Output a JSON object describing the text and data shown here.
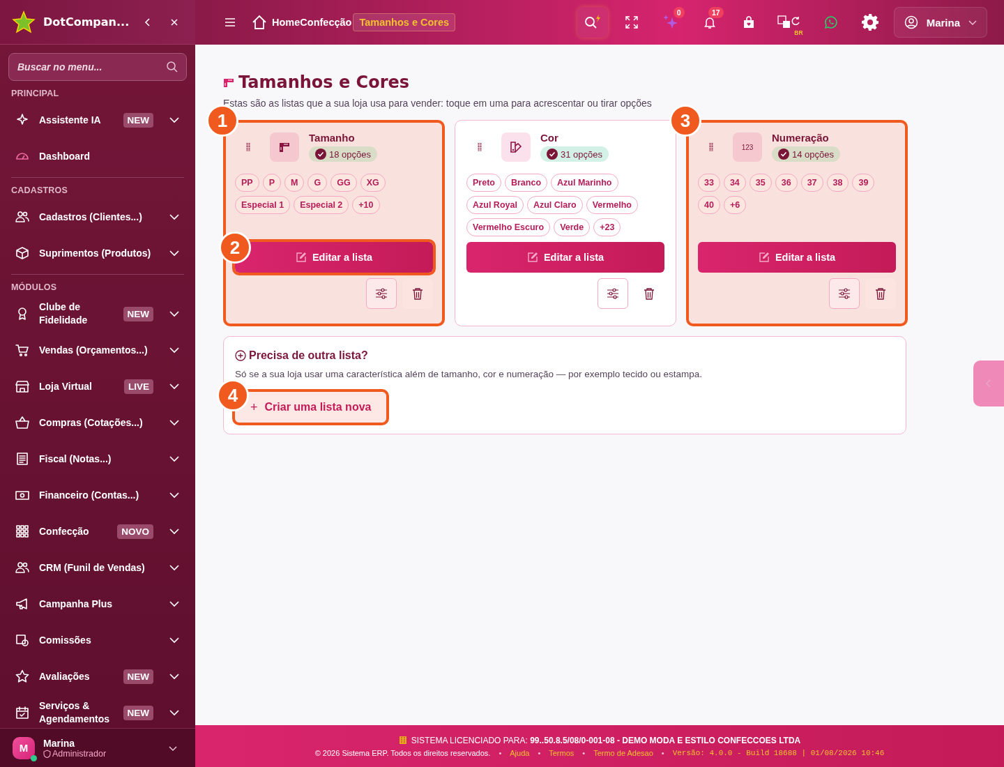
{
  "brand": {
    "name": "DotCompan..."
  },
  "sidebar": {
    "search": {
      "placeholder": "Buscar no menu..."
    },
    "sections": [
      {
        "title": "PRINCIPAL",
        "items": [
          {
            "label": "Assistente IA",
            "badge": "NEW",
            "submenu": true
          },
          {
            "label": "Dashboard",
            "submenu": false
          }
        ]
      },
      {
        "title": "CADASTROS",
        "items": [
          {
            "label": "Cadastros (Clientes...)",
            "submenu": true
          },
          {
            "label": "Suprimentos (Produtos)",
            "submenu": true
          }
        ]
      },
      {
        "title": "MÓDULOS",
        "items": [
          {
            "label": "Clube de Fidelidade",
            "badge": "NEW",
            "submenu": true
          },
          {
            "label": "Vendas (Orçamentos...)",
            "submenu": true
          },
          {
            "label": "Loja Virtual",
            "badge": "LIVE",
            "submenu": true
          },
          {
            "label": "Compras (Cotações...)",
            "submenu": true
          },
          {
            "label": "Fiscal (Notas...)",
            "submenu": true
          },
          {
            "label": "Financeiro (Contas...)",
            "submenu": true
          },
          {
            "label": "Confecção",
            "badge": "NOVO",
            "submenu": true
          },
          {
            "label": "CRM (Funil de Vendas)",
            "submenu": true
          },
          {
            "label": "Campanha Plus",
            "submenu": true
          },
          {
            "label": "Comissões",
            "submenu": true
          },
          {
            "label": "Avaliações",
            "badge": "NEW",
            "submenu": true
          },
          {
            "label": "Serviços & Agendamentos",
            "badge": "NEW",
            "submenu": true
          }
        ]
      }
    ],
    "user": {
      "initial": "M",
      "name": "Marina",
      "role": "Administrador",
      "online": true
    }
  },
  "topbar": {
    "breadcrumb": [
      "Home",
      "Confecção"
    ],
    "current": "Tamanhos e Cores",
    "notifications": [
      {
        "count": "0"
      },
      {
        "count": "17"
      }
    ],
    "language": "BR",
    "user": "Marina"
  },
  "page": {
    "title": "Tamanhos e Cores",
    "subtitle": "Estas são as listas que a sua loja usa para vender: toque em uma para acrescentar ou tirar opções"
  },
  "lists": [
    {
      "kind": "ruler",
      "name": "Tamanho",
      "count": "18 opções",
      "highlighted": true,
      "step": "1",
      "options": [
        "PP",
        "P",
        "M",
        "G",
        "GG",
        "XG",
        "Especial 1",
        "Especial 2",
        "+10"
      ],
      "edit_button": {
        "label": "Editar a lista",
        "highlighted": true,
        "step": "2"
      }
    },
    {
      "kind": "palette",
      "name": "Cor",
      "count": "31 opções",
      "highlighted": false,
      "options": [
        "Preto",
        "Branco",
        "Azul Marinho",
        "Azul Royal",
        "Azul Claro",
        "Vermelho",
        "Vermelho Escuro",
        "Verde",
        "+23"
      ],
      "edit_button": {
        "label": "Editar a lista",
        "highlighted": false
      }
    },
    {
      "kind": "numbers",
      "icon_text": "123",
      "name": "Numeração",
      "count": "14 opções",
      "highlighted": true,
      "step": "3",
      "options": [
        "33",
        "34",
        "35",
        "36",
        "37",
        "38",
        "39",
        "40",
        "+6"
      ],
      "edit_button": {
        "label": "Editar a lista",
        "highlighted": false
      }
    }
  ],
  "new_list": {
    "title": "Precisa de outra lista?",
    "text": "Só se a sua loja usar uma característica além de tamanho, cor e numeração — por exemplo tecido ou estampa.",
    "button": {
      "icon": "+",
      "label": "Criar uma lista nova",
      "highlighted": true,
      "step": "4"
    }
  },
  "footer": {
    "license": "SISTEMA LICENCIADO PARA: **99..50.8.5/08/0-001-08 - DEMO MODA E ESTILO CONFECCOES LTDA**",
    "copyright": "© 2026 Sistema ERP. Todos os direitos reservados.",
    "separator": "•",
    "links": [
      "Ajuda",
      "Termos",
      "Termo de Adesao"
    ],
    "version": "Versão: 4.0.0 - Build 18688 | 01/08/2026 10:46"
  }
}
